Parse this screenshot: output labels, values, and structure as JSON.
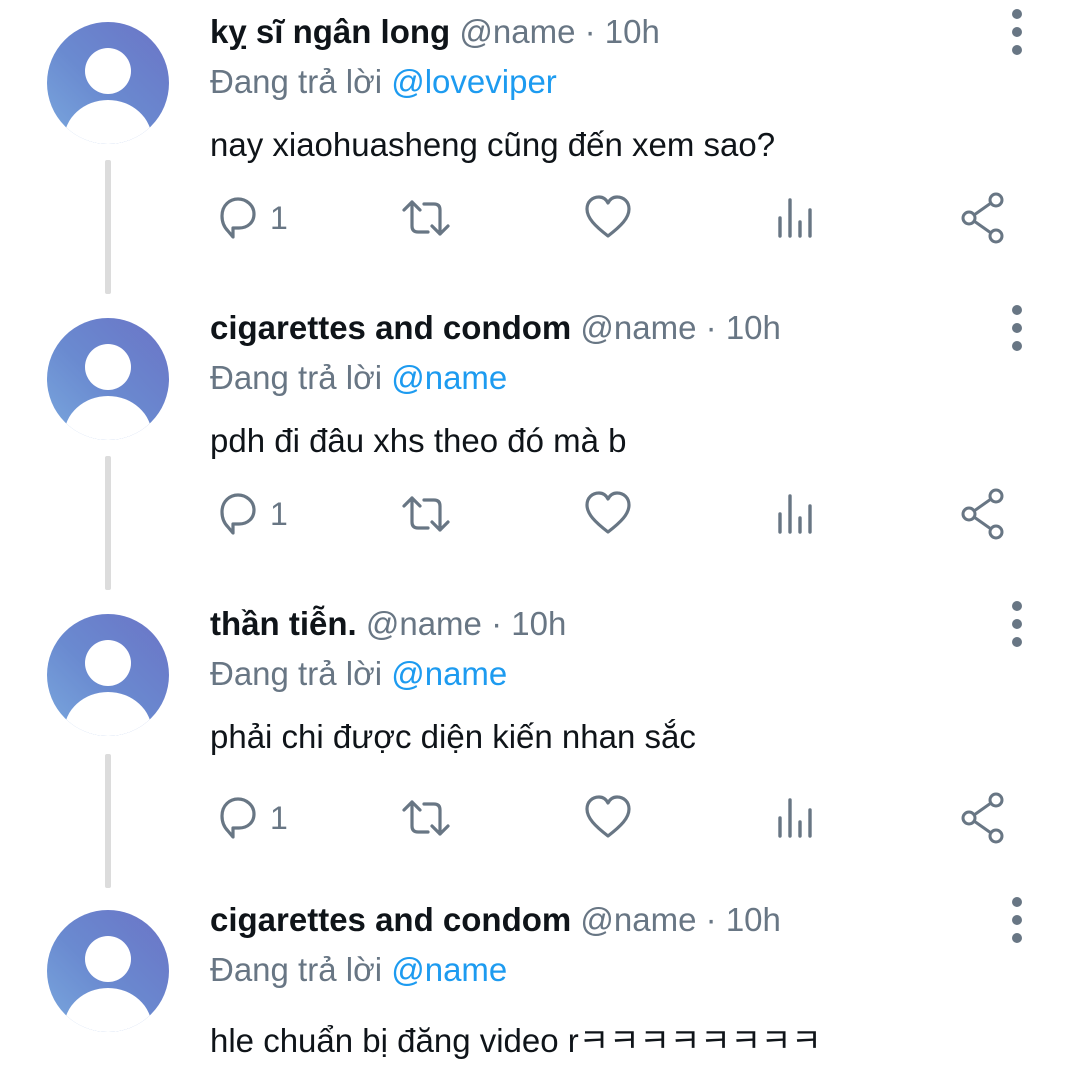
{
  "colors": {
    "name": "#0f1419",
    "meta": "#687684",
    "mention": "#1d9bf0",
    "thread_line": "#dcdcdc",
    "avatar_gradient": [
      "#6b74c6",
      "#7aa8de"
    ]
  },
  "tweets": [
    {
      "name": "kỵ sĩ ngân long",
      "handle": "@name",
      "dot": "·",
      "time": "10h",
      "reply_prefix": "Đang trả lời",
      "reply_to": "@loveviper",
      "text": "nay xiaohuasheng cũng đến xem sao?",
      "reply_count": "1",
      "icons": [
        "avatar-placeholder-icon",
        "more-options-icon",
        "reply-icon",
        "retweet-icon",
        "like-icon",
        "views-icon",
        "share-icon"
      ]
    },
    {
      "name": "cigarettes and condom",
      "handle": "@name",
      "dot": "·",
      "time": "10h",
      "reply_prefix": "Đang trả lời",
      "reply_to": "@name",
      "text": "pdh đi đâu xhs theo đó mà b",
      "reply_count": "1"
    },
    {
      "name": "thần tiễn.",
      "handle": "@name",
      "dot": "·",
      "time": "10h",
      "reply_prefix": "Đang trả lời",
      "reply_to": "@name",
      "text": "phải chi được diện kiến nhan sắc",
      "reply_count": "1"
    },
    {
      "name": "cigarettes and condom",
      "handle": "@name",
      "dot": "·",
      "time": "10h",
      "reply_prefix": "Đang trả lời",
      "reply_to": "@name",
      "text": "hle chuẩn bị đăng video rㅋㅋㅋㅋㅋㅋㅋㅋ"
    }
  ]
}
